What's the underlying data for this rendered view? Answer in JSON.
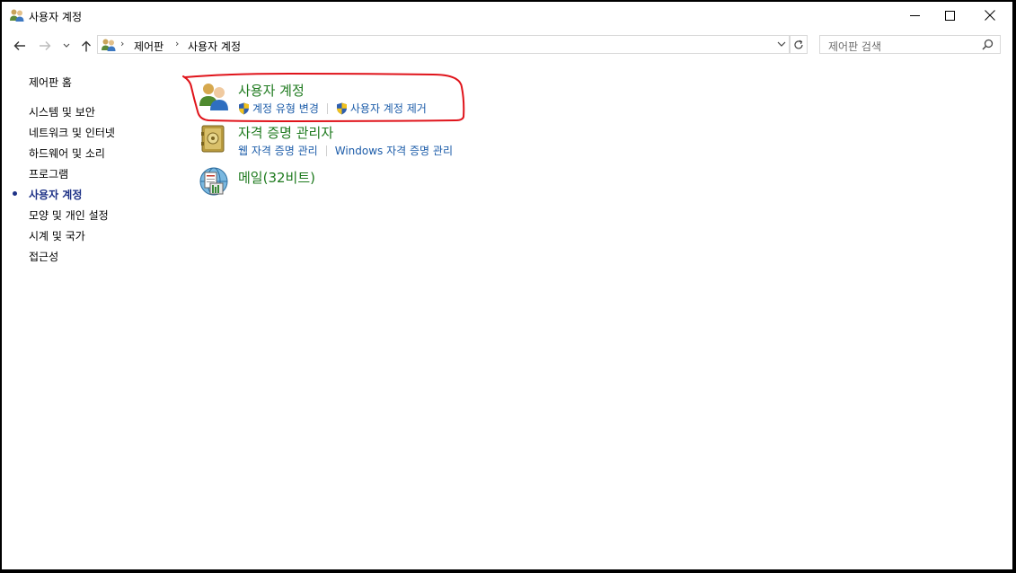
{
  "window": {
    "title": "사용자 계정"
  },
  "address_bar": {
    "crumbs": [
      "제어판",
      "사용자 계정"
    ],
    "search_placeholder": "제어판 검색"
  },
  "left_nav": {
    "items": [
      {
        "label": "제어판 홈"
      },
      {
        "label": "시스템 및 보안"
      },
      {
        "label": "네트워크 및 인터넷"
      },
      {
        "label": "하드웨어 및 소리"
      },
      {
        "label": "프로그램"
      },
      {
        "label": "사용자 계정",
        "active": true
      },
      {
        "label": "모양 및 개인 설정"
      },
      {
        "label": "시계 및 국가"
      },
      {
        "label": "접근성"
      }
    ]
  },
  "categories": [
    {
      "title": "사용자 계정",
      "icon": "user-accounts-icon",
      "links": [
        "계정 유형 변경",
        "사용자 계정 제거"
      ]
    },
    {
      "title": "자격 증명 관리자",
      "icon": "credential-manager-icon",
      "links": [
        "웹 자격 증명 관리",
        "Windows 자격 증명 관리"
      ]
    },
    {
      "title": "메일(32비트)",
      "icon": "mail-icon",
      "links": []
    }
  ],
  "colors": {
    "category_title": "#1e7a1e",
    "link": "#1c5ca9",
    "active_nav": "#1e3287",
    "annotation": "#e0141b"
  }
}
